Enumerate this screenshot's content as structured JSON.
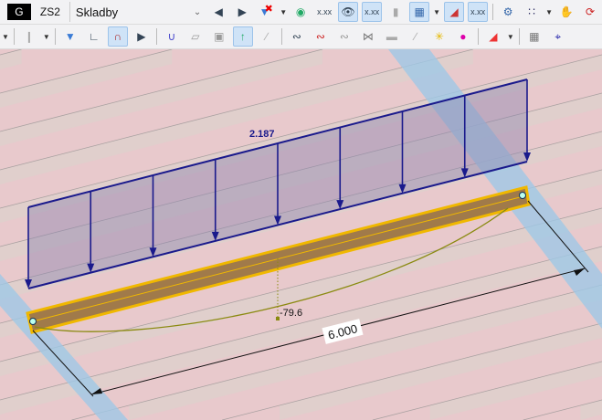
{
  "toolbar": {
    "load_case_badge": "G",
    "load_case_id": "ZS2",
    "load_case_name": "Skladby",
    "dropdown_icon": "chevron-down-icon",
    "prev_icon": "triangle-left-icon",
    "next_icon": "triangle-right-icon",
    "value_label": "x.xx"
  },
  "viewport": {
    "load_value": "2.187",
    "moment_value": "-79.6",
    "dimension_value": "6.000",
    "colors": {
      "background": "#e8c9cc",
      "load": "#1a1a8c",
      "beam": "#a07a4a",
      "beam_outline": "#f0b800",
      "moment": "#8a8a10",
      "band": "#9fc8e6"
    }
  }
}
